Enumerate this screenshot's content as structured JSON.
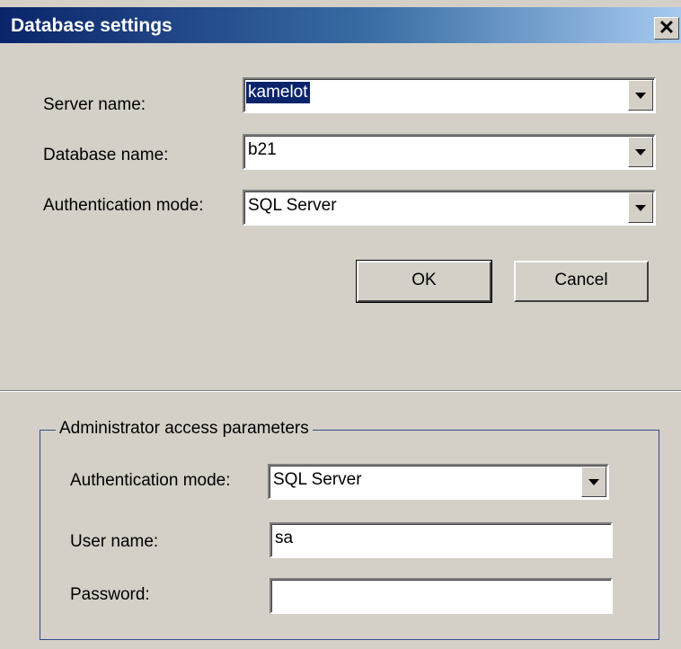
{
  "window": {
    "title": "Database settings",
    "close_glyph": "✕",
    "close_icon": "close-icon"
  },
  "main": {
    "server": {
      "label": "Server name:",
      "value": "kamelot"
    },
    "database": {
      "label": "Database name:",
      "value": "b21"
    },
    "auth": {
      "label": "Authentication mode:",
      "value": "SQL Server"
    },
    "ok_label": "OK",
    "cancel_label": "Cancel"
  },
  "admin": {
    "group_title": "Administrator access parameters",
    "auth": {
      "label": "Authentication mode:",
      "value": "SQL Server"
    },
    "user": {
      "label": "User name:",
      "value": "sa"
    },
    "password": {
      "label": "Password:",
      "value": ""
    }
  },
  "colors": {
    "title_start": "#0a246a",
    "title_end": "#a6caf0",
    "face": "#d4d0c8",
    "groupbox_border": "#334a8a",
    "selection": "#0a246a"
  }
}
